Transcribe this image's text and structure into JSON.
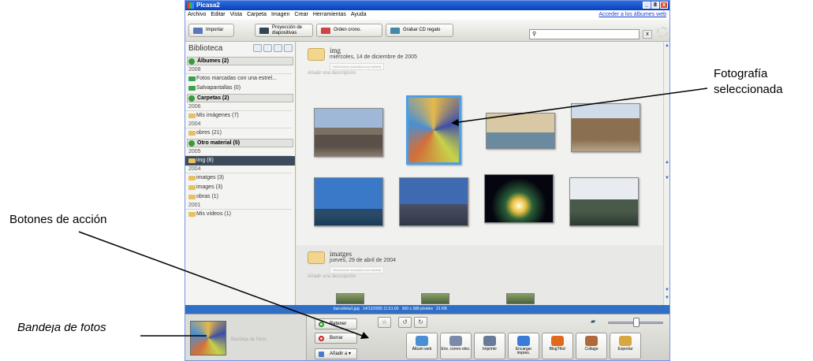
{
  "window": {
    "title": "Picasa2",
    "controls": [
      "_",
      "8",
      "x"
    ]
  },
  "menu": {
    "items": [
      "Archivo",
      "Editar",
      "Vista",
      "Carpeta",
      "Imagen",
      "Crear",
      "Herramientas",
      "Ayuda"
    ],
    "sync_link": "Acceder a los álbumes web"
  },
  "toolbar": {
    "import": "Importar",
    "slideshow": "Proyección de diapositivas",
    "timeline": "Orden crono.",
    "burn": "Grabar CD regalo",
    "search_placeholder": "",
    "search_clear": "x"
  },
  "library": {
    "title": "Biblioteca",
    "sections": [
      {
        "label": "Álbumes (2)",
        "groups": [
          {
            "year": "2008",
            "items": [
              "Fotos marcadas con una estrel...",
              "Salvapantallas (0)"
            ]
          }
        ]
      },
      {
        "label": "Carpetas (2)",
        "groups": [
          {
            "year": "2006",
            "items": [
              "Mis imágenes (7)"
            ]
          },
          {
            "year": "2004",
            "items": [
              "obres (21)"
            ]
          }
        ]
      },
      {
        "label": "Otro material (5)",
        "groups": [
          {
            "year": "2005",
            "items": [
              "img (8)"
            ]
          },
          {
            "year": "2004",
            "items": [
              "imatges (3)",
              "images (3)",
              "obras (1)"
            ]
          },
          {
            "year": "2001",
            "items": [
              "Mis vídeos (1)"
            ]
          }
        ]
      }
    ]
  },
  "folders": [
    {
      "name": "img",
      "date": "miércoles, 14 de diciembre de 2005",
      "star_button": "Seleccionar marcados con estrella",
      "description": "Añadir una descripción"
    },
    {
      "name": "imatges",
      "date": "jueves, 29 de abril de 2004",
      "star_button": "Seleccionar marcados con estrella",
      "description": "Añadir una descripción"
    }
  ],
  "status": {
    "filename": "barcelona1.jpg",
    "datetime": "14/12/2005 11:51:00",
    "dimensions": "300 x 388 píxeles",
    "size": "31 KB"
  },
  "tray": {
    "label": "Bandeja de fotos",
    "hold": "Retener",
    "clear": "Borrar",
    "add_to": "Añadir a"
  },
  "actions": [
    "Álbum web",
    "Env. correo elec.",
    "Imprimir",
    "Encargar impres.",
    "BlogThis!",
    "Collage",
    "Exportar"
  ],
  "action_colors": [
    "#4a8fd2",
    "#7a8aa8",
    "#6a7a9a",
    "#3a7ad8",
    "#e06a1a",
    "#b06a3a",
    "#d8a840"
  ],
  "annotations": {
    "selected_photo": [
      "Fotografía",
      "seleccionada"
    ],
    "action_buttons": "Botones de acción",
    "photo_tray": "Bandeja de fotos"
  }
}
